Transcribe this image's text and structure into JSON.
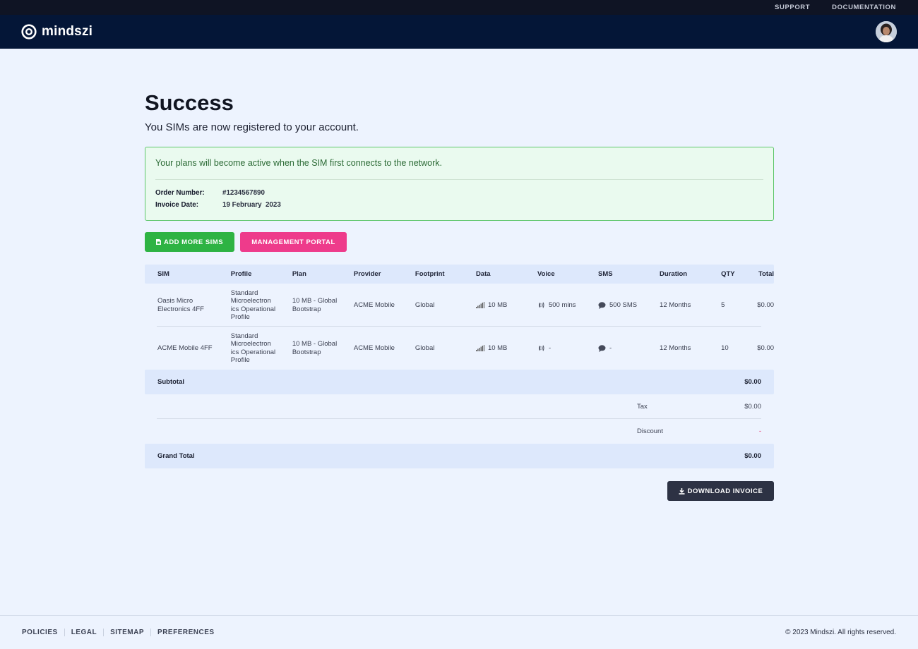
{
  "utility_nav": {
    "support": "SUPPORT",
    "documentation": "DOCUMENTATION"
  },
  "brand": {
    "name": "mindszi"
  },
  "page": {
    "title": "Success",
    "subtitle": "You SIMs are now registered to your account."
  },
  "alert": {
    "message": "Your plans will become active when the SIM first connects to the network.",
    "order_label": "Order Number:",
    "order_value": "#1234567890",
    "invoice_label": "Invoice Date:",
    "invoice_value": "19 February  2023"
  },
  "actions": {
    "add_more": "ADD MORE SIMS",
    "portal": "MANAGEMENT PORTAL",
    "download": "DOWNLOAD INVOICE"
  },
  "table": {
    "headers": [
      "SIM",
      "Profile",
      "Plan",
      "Provider",
      "Footprint",
      "Data",
      "Voice",
      "SMS",
      "Duration",
      "QTY",
      "Total"
    ],
    "rows": [
      {
        "sim": "Oasis Micro Electronics 4FF",
        "profile": "Standard Microelectron ics Operational Profile",
        "plan": "10 MB - Global Bootstrap",
        "provider": "ACME Mobile",
        "footprint": "Global",
        "data": "10 MB",
        "voice": "500 mins",
        "sms": "500 SMS",
        "duration": "12 Months",
        "qty": "5",
        "total": "$0.00"
      },
      {
        "sim": "ACME Mobile 4FF",
        "profile": "Standard Microelectron ics Operational Profile",
        "plan": "10 MB - Global Bootstrap",
        "provider": "ACME Mobile",
        "footprint": "Global",
        "data": "10 MB",
        "voice": "-",
        "sms": "-",
        "duration": "12 Months",
        "qty": "10",
        "total": "$0.00"
      }
    ]
  },
  "summary": {
    "subtotal_label": "Subtotal",
    "subtotal_value": "$0.00",
    "tax_label": "Tax",
    "tax_value": "$0.00",
    "discount_label": "Discount",
    "discount_value": "-",
    "grand_total_label": "Grand Total",
    "grand_total_value": "$0.00"
  },
  "footer": {
    "links": [
      "POLICIES",
      "LEGAL",
      "SITEMAP",
      "PREFERENCES"
    ],
    "copyright": "© 2023 Mindszi. All rights reserved."
  },
  "colors": {
    "header_bg": "#041637",
    "success_green": "#2eb343",
    "accent_pink": "#ee3b8b",
    "dark_button": "#2d3244",
    "discount_red": "#e83a74"
  }
}
